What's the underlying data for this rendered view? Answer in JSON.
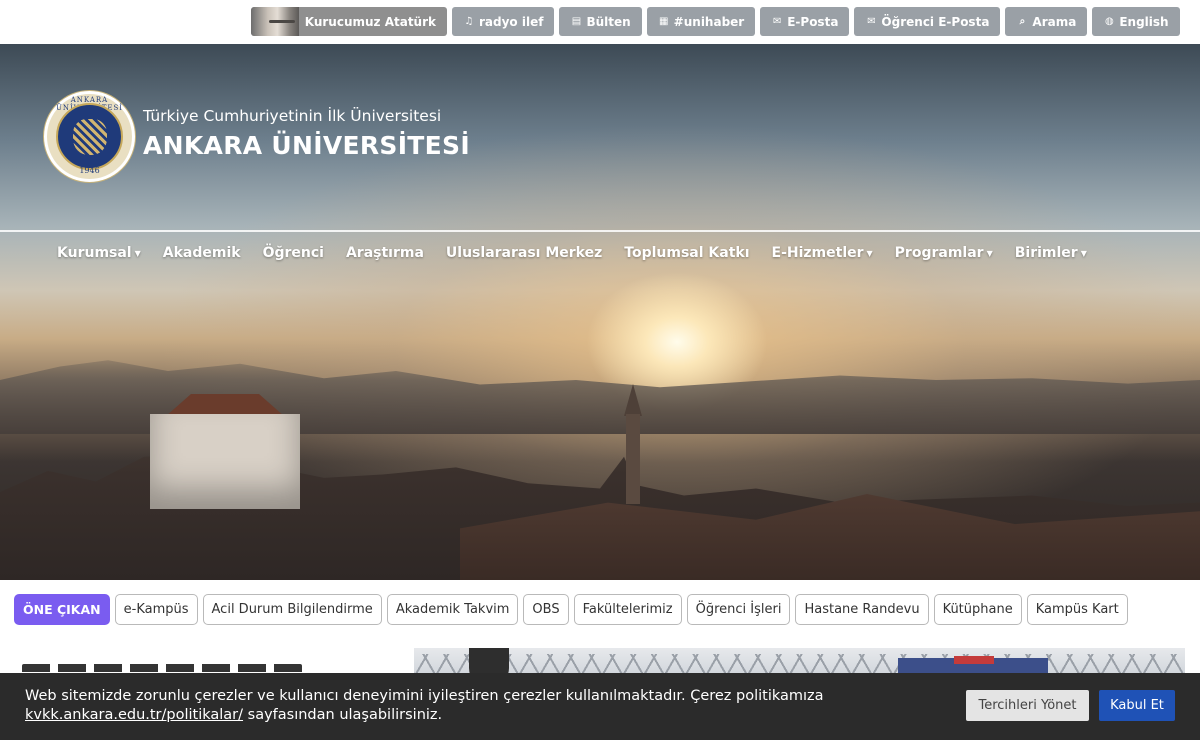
{
  "topbar": {
    "links": [
      {
        "label": "Kurucumuz Atatürk",
        "icon": "atatürk-portrait"
      },
      {
        "label": "radyo ilef",
        "icon": "music-note-icon"
      },
      {
        "label": "Bülten",
        "icon": "newspaper-icon"
      },
      {
        "label": "#unihaber",
        "icon": "newspaper-icon"
      },
      {
        "label": "E-Posta",
        "icon": "envelope-icon"
      },
      {
        "label": "Öğrenci E-Posta",
        "icon": "envelope-icon"
      },
      {
        "label": "Arama",
        "icon": "search-icon"
      },
      {
        "label": "English",
        "icon": "globe-icon"
      }
    ]
  },
  "header": {
    "seal_text": "ANKARA ÜNİVERSİTESİ",
    "seal_year": "1946",
    "tagline": "Türkiye Cumhuriyetinin İlk Üniversitesi",
    "name": "ANKARA ÜNİVERSİTESİ"
  },
  "nav": {
    "items": [
      {
        "label": "Kurumsal",
        "dropdown": true
      },
      {
        "label": "Akademik",
        "dropdown": false
      },
      {
        "label": "Öğrenci",
        "dropdown": false
      },
      {
        "label": "Araştırma",
        "dropdown": false
      },
      {
        "label": "Uluslararası Merkez",
        "dropdown": false
      },
      {
        "label": "Toplumsal Katkı",
        "dropdown": false
      },
      {
        "label": "E-Hizmetler",
        "dropdown": true
      },
      {
        "label": "Programlar",
        "dropdown": true
      },
      {
        "label": "Birimler",
        "dropdown": true
      }
    ]
  },
  "featured": {
    "badge": "ÖNE ÇIKAN",
    "links": [
      "e-Kampüs",
      "Acil Durum Bilgilendirme",
      "Akademik Takvim",
      "OBS",
      "Fakültelerimiz",
      "Öğrenci İşleri",
      "Hastane Randevu",
      "Kütüphane",
      "Kampüs Kart"
    ]
  },
  "cookie": {
    "text_before": "Web sitemizde zorunlu çerezler ve kullanıcı deneyimini iyileştiren çerezler kullanılmaktadır. Çerez politikamıza",
    "link": "kvkk.ankara.edu.tr/politikalar/",
    "text_after": " sayfasından ulaşabilirsiniz.",
    "prefs_label": "Tercihleri Yönet",
    "accept_label": "Kabul Et"
  },
  "colors": {
    "topbar_button": "#9aa0a6",
    "badge": "#7a5cf0",
    "cookie_bg": "#2b2b2b",
    "accept": "#1f52b6"
  }
}
